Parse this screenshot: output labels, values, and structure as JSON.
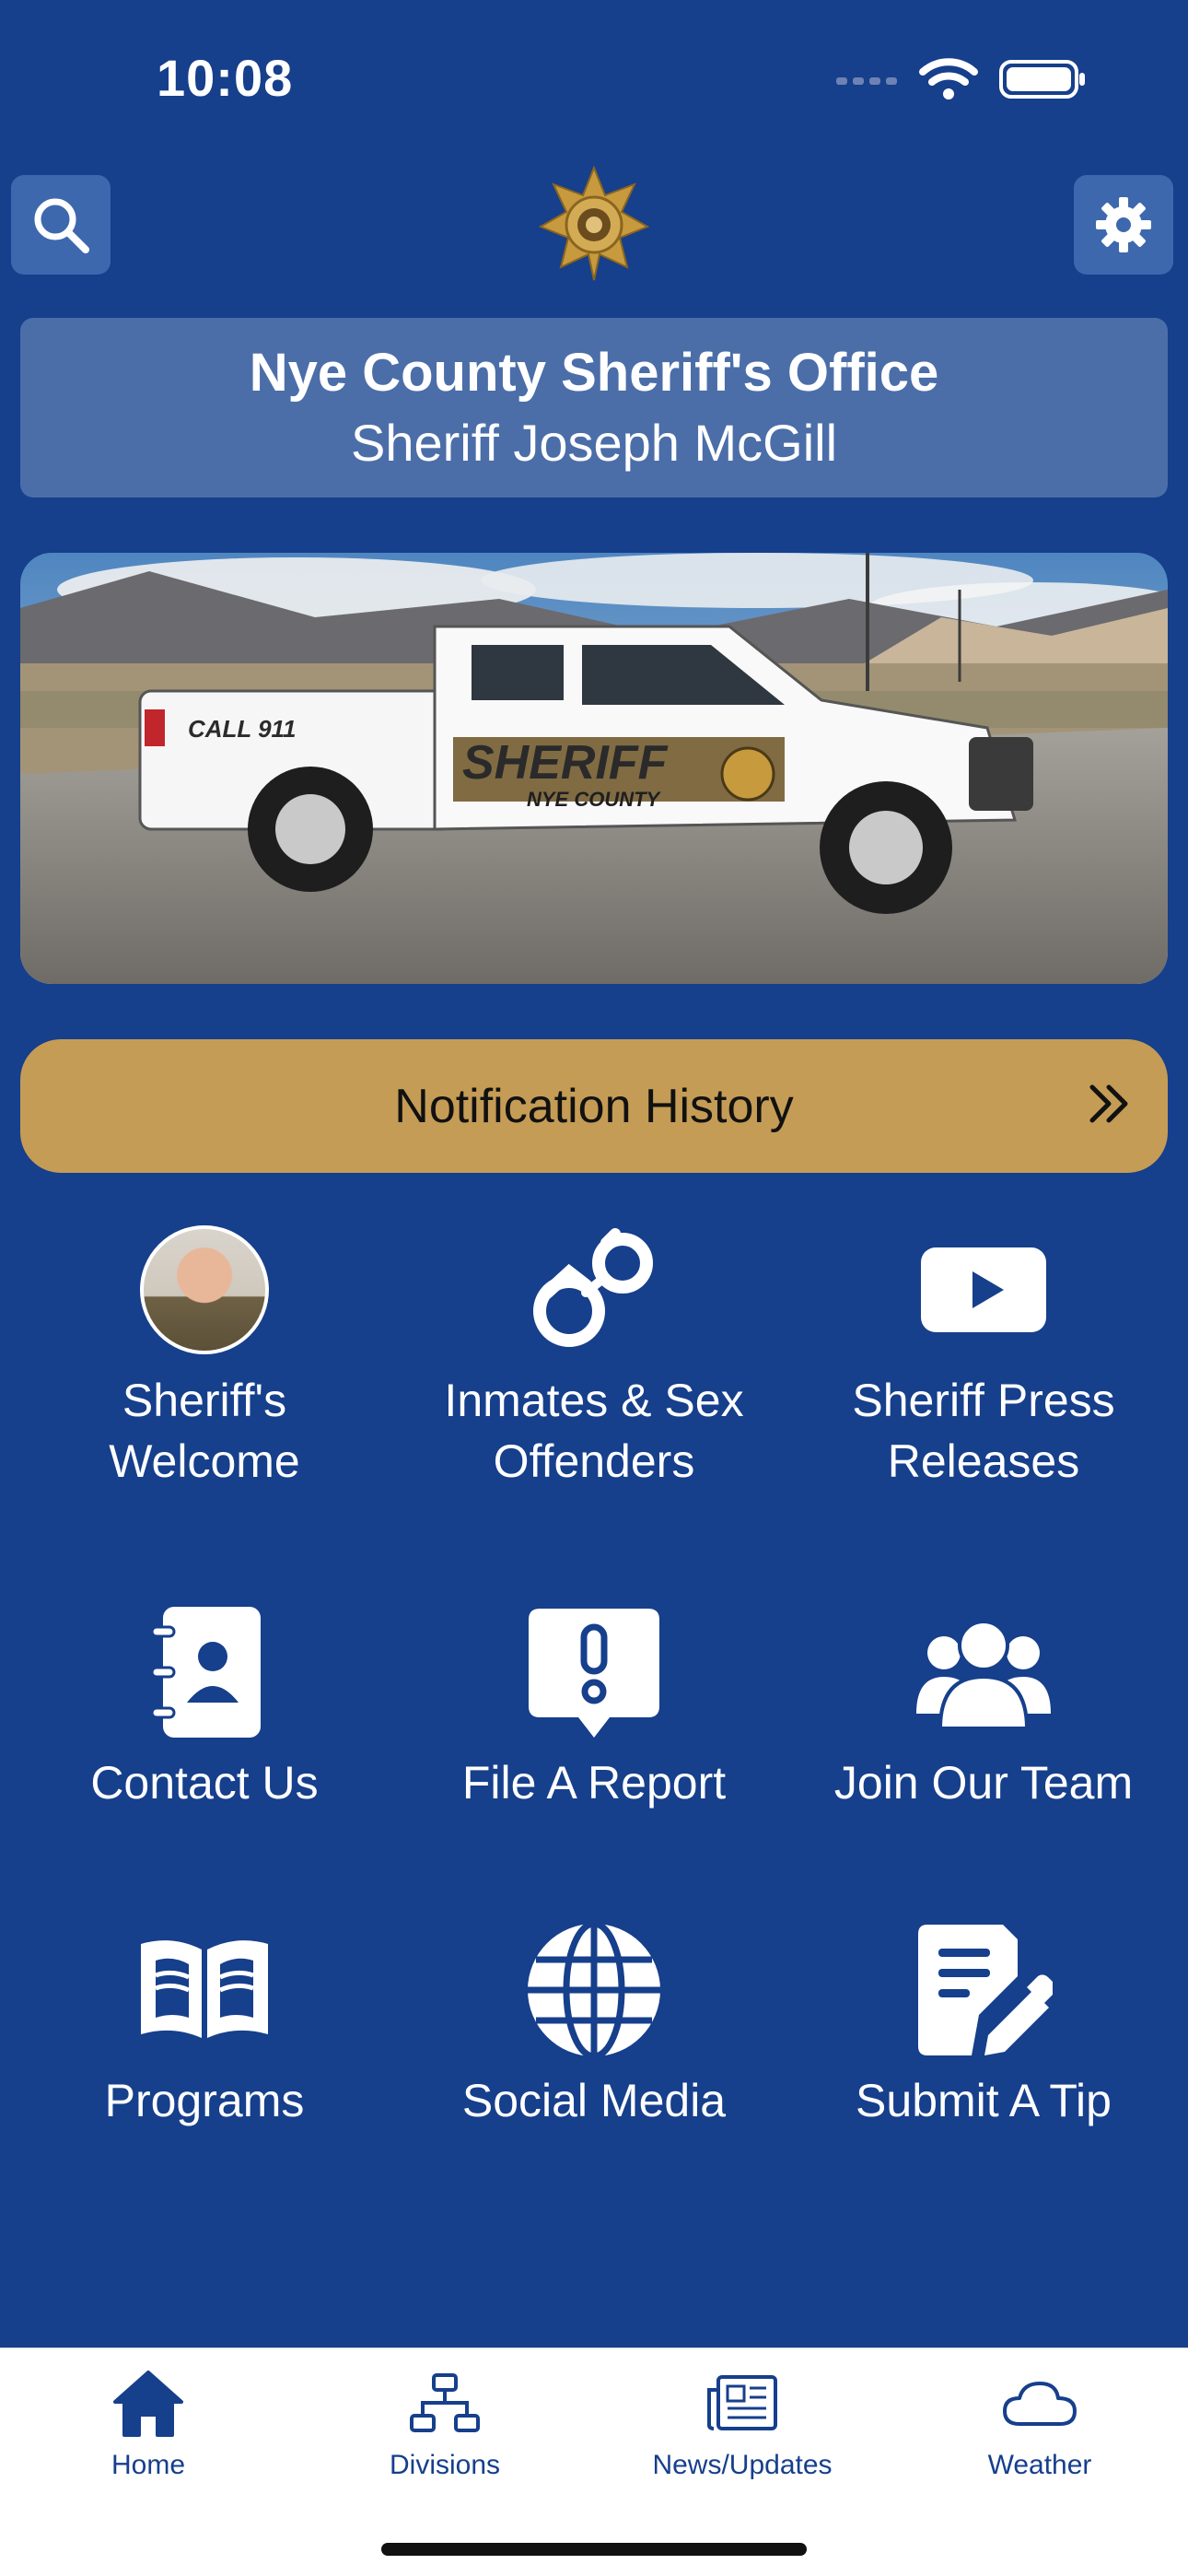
{
  "status_bar": {
    "time": "10:08"
  },
  "header": {
    "title": "Nye County Sheriff's Office",
    "subtitle": "Sheriff Joseph McGill"
  },
  "hero": {
    "truck_text": "SHERIFF",
    "truck_subtext": "NYE COUNTY",
    "call_text": "CALL 911"
  },
  "notification": {
    "label": "Notification History"
  },
  "tiles": [
    {
      "label": "Sheriff's Welcome",
      "icon": "sheriff-avatar"
    },
    {
      "label": "Inmates & Sex Offenders",
      "icon": "handcuffs-icon"
    },
    {
      "label": "Sheriff Press Releases",
      "icon": "play-icon"
    },
    {
      "label": "Contact Us",
      "icon": "contact-book-icon"
    },
    {
      "label": "File A Report",
      "icon": "alert-bubble-icon"
    },
    {
      "label": "Join Our Team",
      "icon": "users-icon"
    },
    {
      "label": "Programs",
      "icon": "open-book-icon"
    },
    {
      "label": "Social Media",
      "icon": "globe-icon"
    },
    {
      "label": "Submit A Tip",
      "icon": "edit-document-icon"
    }
  ],
  "tabs": [
    {
      "label": "Home",
      "icon": "home-icon",
      "active": true
    },
    {
      "label": "Divisions",
      "icon": "org-chart-icon",
      "active": false
    },
    {
      "label": "News/Updates",
      "icon": "newspaper-icon",
      "active": false
    },
    {
      "label": "Weather",
      "icon": "cloud-icon",
      "active": false
    }
  ],
  "colors": {
    "background": "#163f8c",
    "card": "#4b6ea9",
    "accent_gold": "#c59c55",
    "tab_bar": "#ffffff"
  }
}
